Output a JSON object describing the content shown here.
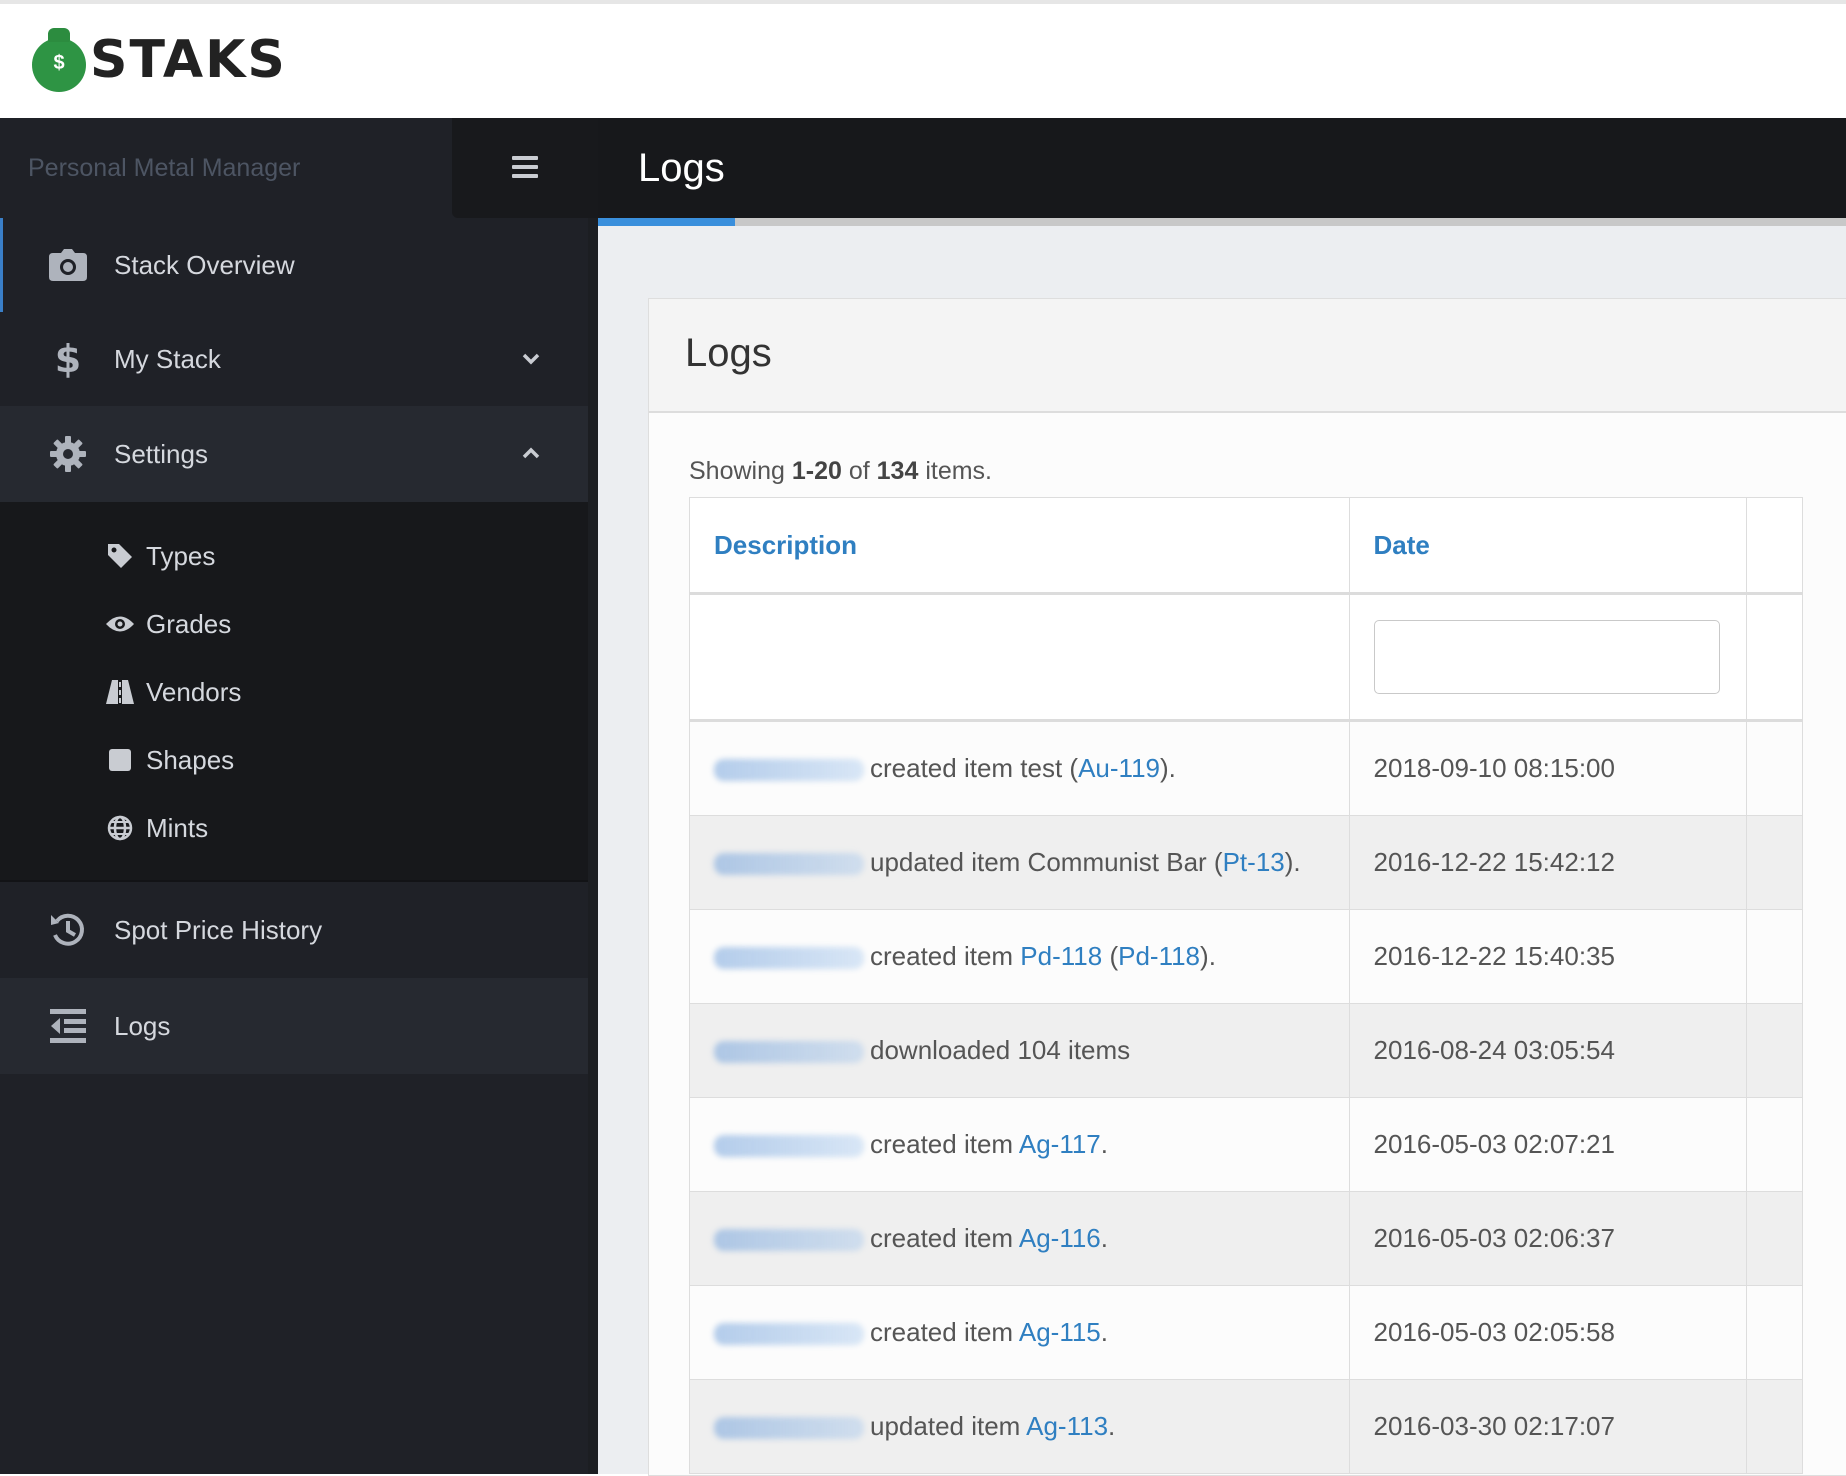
{
  "app": {
    "logo_text": "STAKS",
    "logo_symbol": "$",
    "subtitle": "Personal Metal Manager"
  },
  "nav": {
    "stack_overview": "Stack Overview",
    "my_stack": "My Stack",
    "settings": "Settings",
    "settings_items": {
      "types": "Types",
      "grades": "Grades",
      "vendors": "Vendors",
      "shapes": "Shapes",
      "mints": "Mints"
    },
    "spot_price_history": "Spot Price History",
    "logs": "Logs"
  },
  "page": {
    "title": "Logs",
    "load_progress": 0.11
  },
  "panel": {
    "title": "Logs",
    "summary": {
      "prefix": "Showing ",
      "range": "1-20",
      "of": " of ",
      "total": "134",
      "suffix": " items."
    }
  },
  "table": {
    "columns": {
      "description": "Description",
      "date": "Date"
    },
    "date_filter_value": "",
    "rows": [
      {
        "action": "created item test (",
        "link1": "Au-119",
        "mid": "",
        "link2": "",
        "tail": ").",
        "date": "2018-09-10 08:15:00"
      },
      {
        "action": "updated item Communist Bar (",
        "link1": "Pt-13",
        "mid": "",
        "link2": "",
        "tail": ").",
        "date": "2016-12-22 15:42:12"
      },
      {
        "action": "created item ",
        "link1": "Pd-118",
        "mid": " (",
        "link2": "Pd-118",
        "tail": ").",
        "date": "2016-12-22 15:40:35"
      },
      {
        "action": "downloaded 104 items",
        "link1": "",
        "mid": "",
        "link2": "",
        "tail": "",
        "date": "2016-08-24 03:05:54"
      },
      {
        "action": "created item ",
        "link1": "Ag-117",
        "mid": "",
        "link2": "",
        "tail": ".",
        "date": "2016-05-03 02:07:21"
      },
      {
        "action": "created item ",
        "link1": "Ag-116",
        "mid": "",
        "link2": "",
        "tail": ".",
        "date": "2016-05-03 02:06:37"
      },
      {
        "action": "created item ",
        "link1": "Ag-115",
        "mid": "",
        "link2": "",
        "tail": ".",
        "date": "2016-05-03 02:05:58"
      },
      {
        "action": "updated item ",
        "link1": "Ag-113",
        "mid": "",
        "link2": "",
        "tail": ".",
        "date": "2016-03-30 02:17:07"
      }
    ]
  },
  "colors": {
    "sidebar_bg": "#1f2127",
    "topbar_bg": "#17181b",
    "accent_blue": "#2f7fc1",
    "logo_green": "#2e9444"
  }
}
